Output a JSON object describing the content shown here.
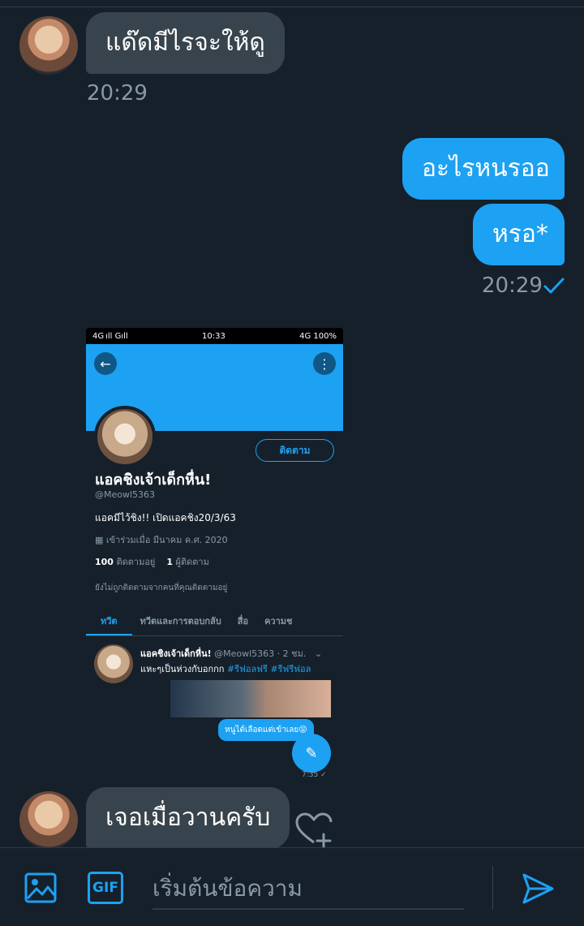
{
  "conversation": {
    "messages": [
      {
        "direction": "in",
        "text": "แด๊ดมีไรจะให้ดู",
        "time": "20:29"
      },
      {
        "direction": "out",
        "text": "อะไรหนรออ"
      },
      {
        "direction": "out",
        "text": "หรอ*",
        "time": "20:29",
        "status": "sent-check"
      },
      {
        "direction": "in",
        "text": "เจอเมื่อวานครับ"
      }
    ]
  },
  "shared_screenshot": {
    "status_bar": {
      "left": "4G ıll Gıll",
      "time": "10:33",
      "right": "4G 100%"
    },
    "profile": {
      "name": "แอคชิงเจ้าเด็กหื่น!",
      "handle": "@Meowl5363",
      "bio": "แอคมีไว้ชิง!! เปิดแอคชิง20/3/63",
      "joined": "เข้าร่วมเมื่อ มีนาคม ค.ศ. 2020",
      "following_count": "100",
      "following_label": "ติดตามอยู่",
      "followers_count": "1",
      "followers_label": "ผู้ติดตาม",
      "note": "ยังไม่ถูกติดตามจากคนที่คุณติดตามอยู่",
      "follow_button": "ติดตาม"
    },
    "tabs": [
      "ทวีต",
      "ทวีตและการตอบกลับ",
      "สื่อ",
      "ความช"
    ],
    "tweet": {
      "name": "แอคชิงเจ้าเด็กหื่น!",
      "meta": "@Meowl5363 · 2 ชม.",
      "text": "แหะๆเป็นห่วงกับอกกก",
      "hashtags": "#รีฟอลฟรี #รีฟรีฟอล",
      "reply_bubble": "หนูได้เลือดแต่เข้าเลย😝",
      "reply_time": "7:35 ✓"
    }
  },
  "composer": {
    "placeholder": "เริ่มต้นข้อความ",
    "gif_label": "GIF"
  },
  "colors": {
    "background": "#15202b",
    "accent": "#1da1f2",
    "incoming_bubble": "#38444d",
    "muted_text": "#8899a6"
  },
  "icons": [
    "image-icon",
    "gif-icon",
    "send-icon",
    "heart-add-icon",
    "check-icon",
    "back-arrow-icon",
    "more-options-icon",
    "compose-tweet-icon",
    "calendar-icon"
  ]
}
